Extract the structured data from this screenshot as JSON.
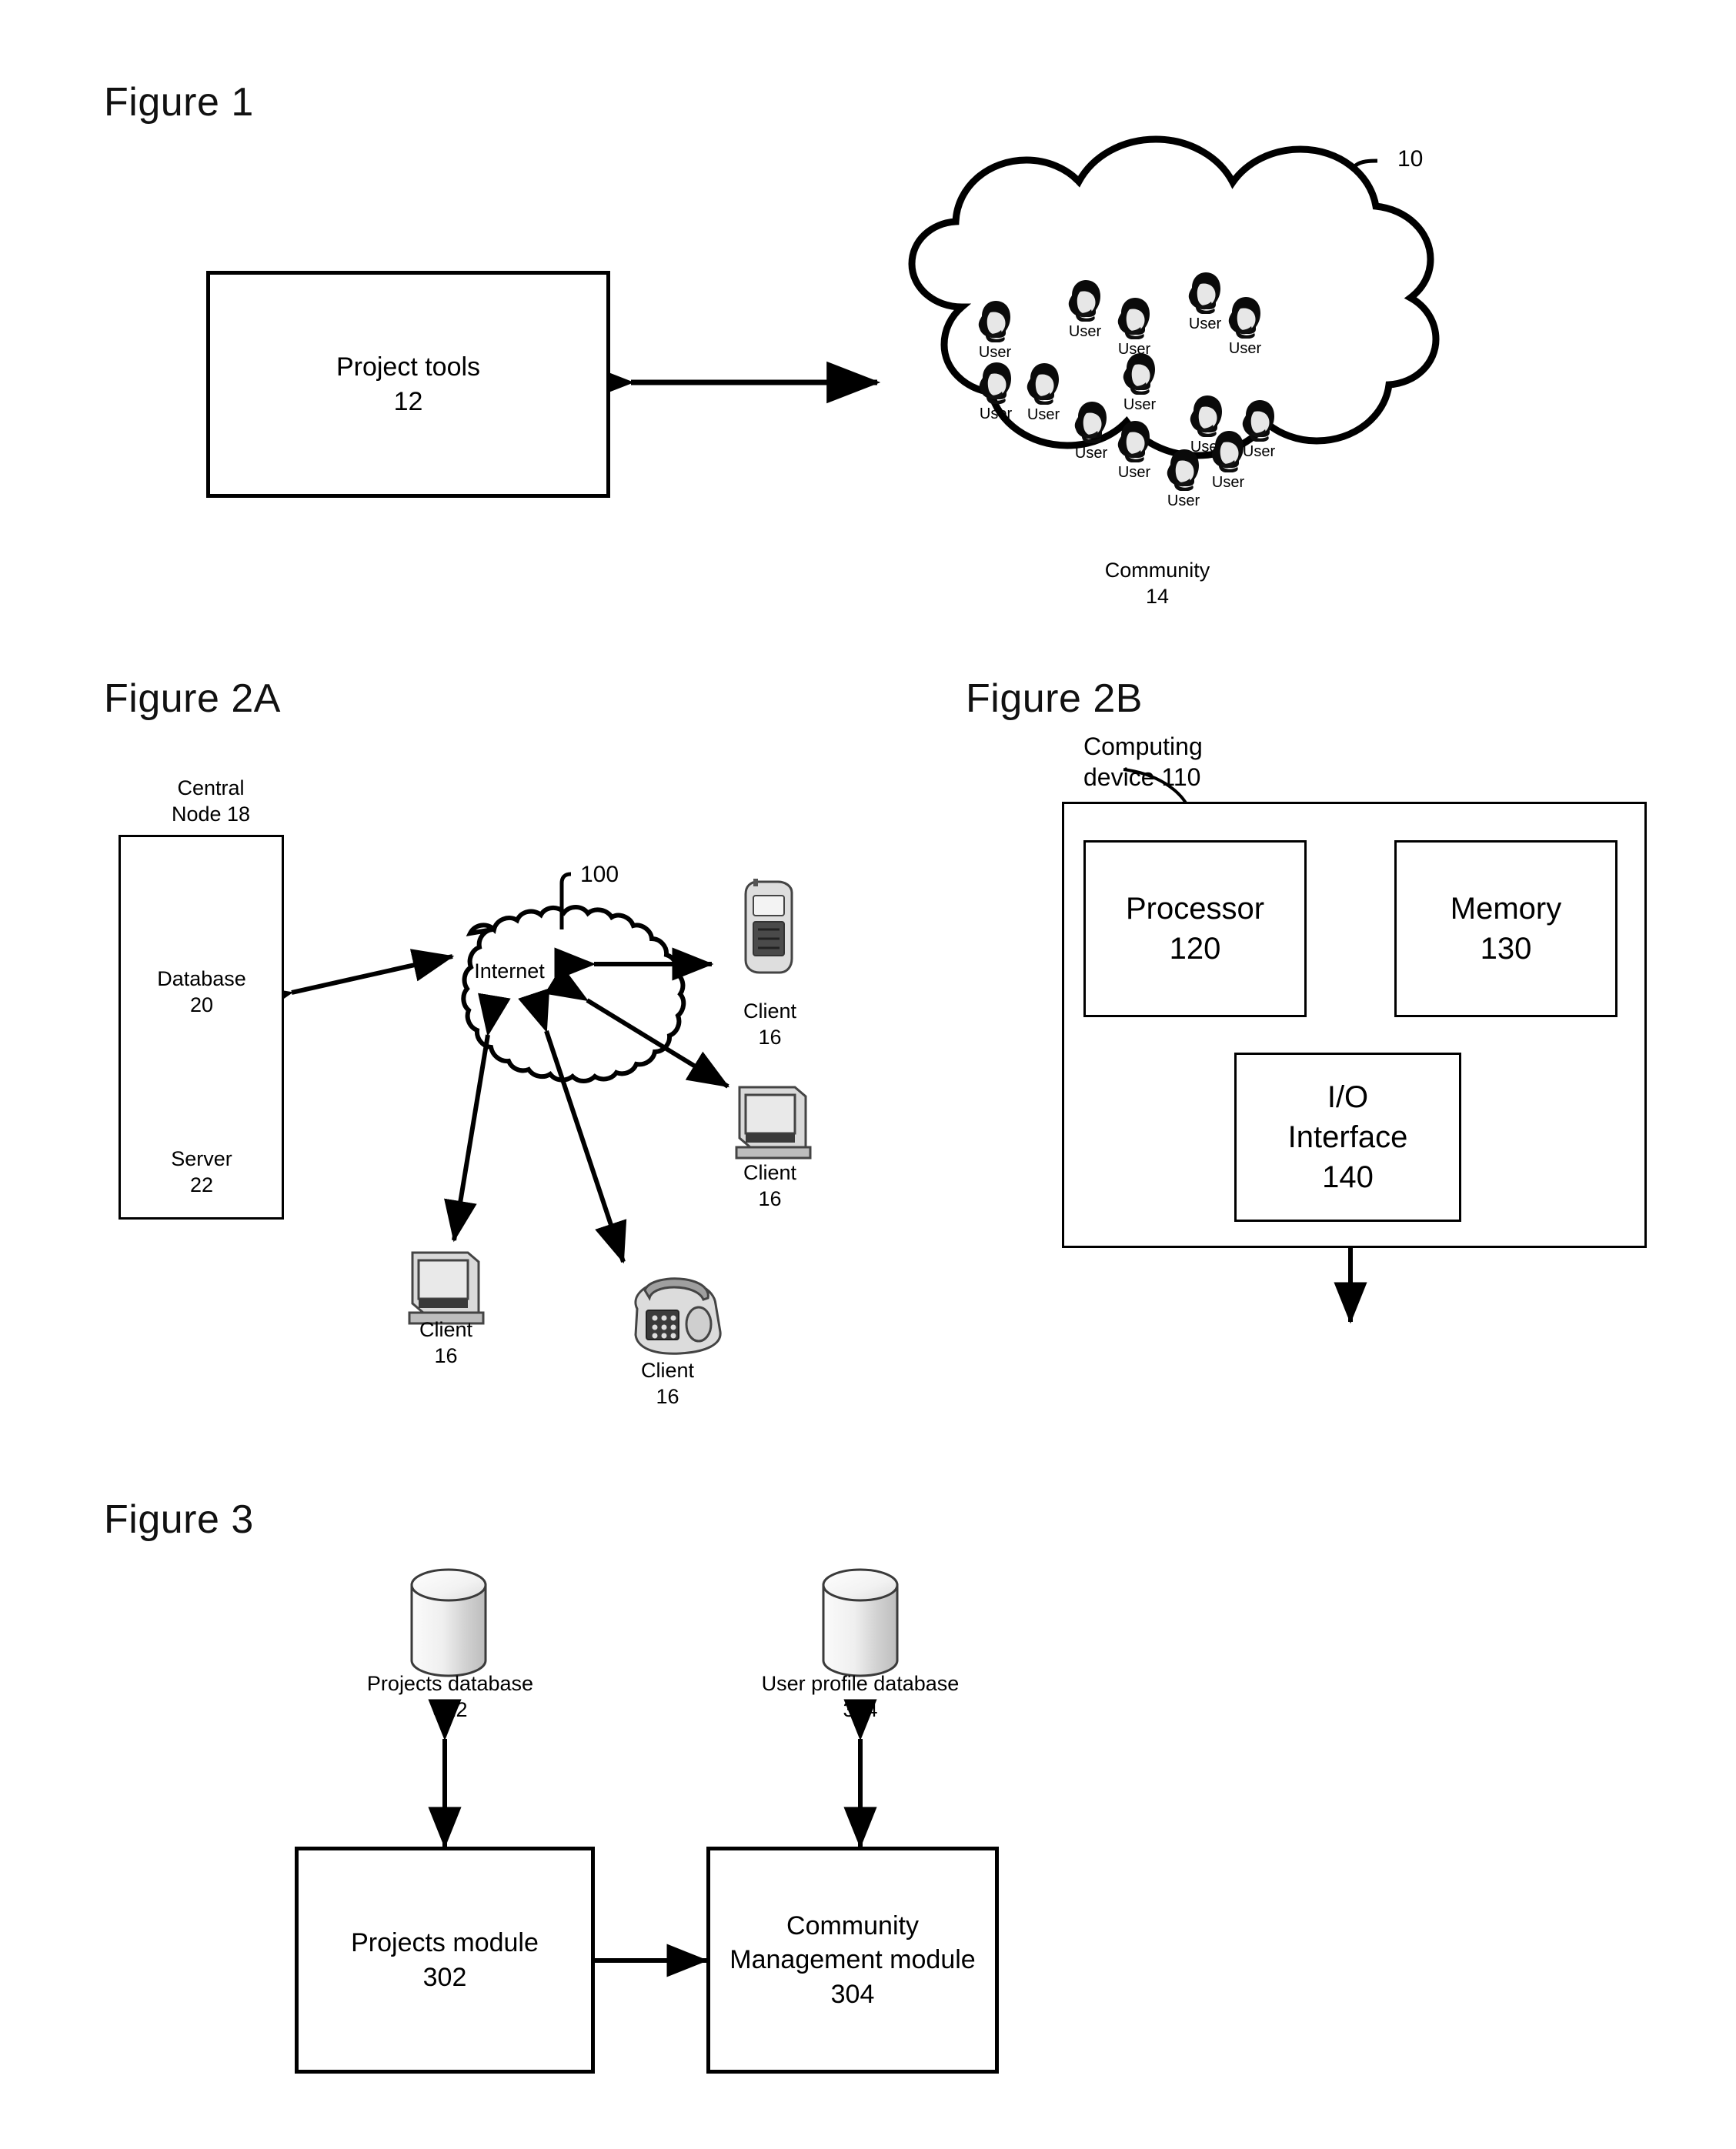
{
  "figures": {
    "fig1": {
      "title": "Figure 1",
      "ref": "10",
      "project_tools": {
        "label": "Project tools\n12"
      },
      "community": {
        "label": "Community\n14",
        "user_label": "User",
        "user_count": 14
      }
    },
    "fig2a": {
      "title": "Figure 2A",
      "central_node": {
        "label": "Central\nNode 18"
      },
      "database": {
        "label": "Database\n20"
      },
      "server": {
        "label": "Server\n22"
      },
      "internet": {
        "label": "Internet",
        "ref": "100"
      },
      "clients": [
        {
          "label": "Client\n16",
          "device": "mobile-phone"
        },
        {
          "label": "Client\n16",
          "device": "desktop-computer"
        },
        {
          "label": "Client\n16",
          "device": "desktop-computer"
        },
        {
          "label": "Client\n16",
          "device": "telephone"
        }
      ]
    },
    "fig2b": {
      "title": "Figure 2B",
      "computing_device": {
        "label": "Computing\ndevice 110"
      },
      "processor": {
        "label": "Processor\n120"
      },
      "memory": {
        "label": "Memory\n130"
      },
      "io_interface": {
        "label": "I/O\nInterface\n140"
      }
    },
    "fig3": {
      "title": "Figure 3",
      "projects_database": {
        "label": "Projects database\n312"
      },
      "user_profile_database": {
        "label": "User profile database\n314"
      },
      "projects_module": {
        "label": "Projects module\n302"
      },
      "community_module": {
        "label": "Community\nManagement module\n304"
      }
    }
  },
  "colors": {
    "ink": "#000000",
    "paper": "#ffffff",
    "shade_light": "#e8e8e8",
    "shade_mid": "#cfcfcf",
    "shade_dark": "#9a9a9a"
  }
}
